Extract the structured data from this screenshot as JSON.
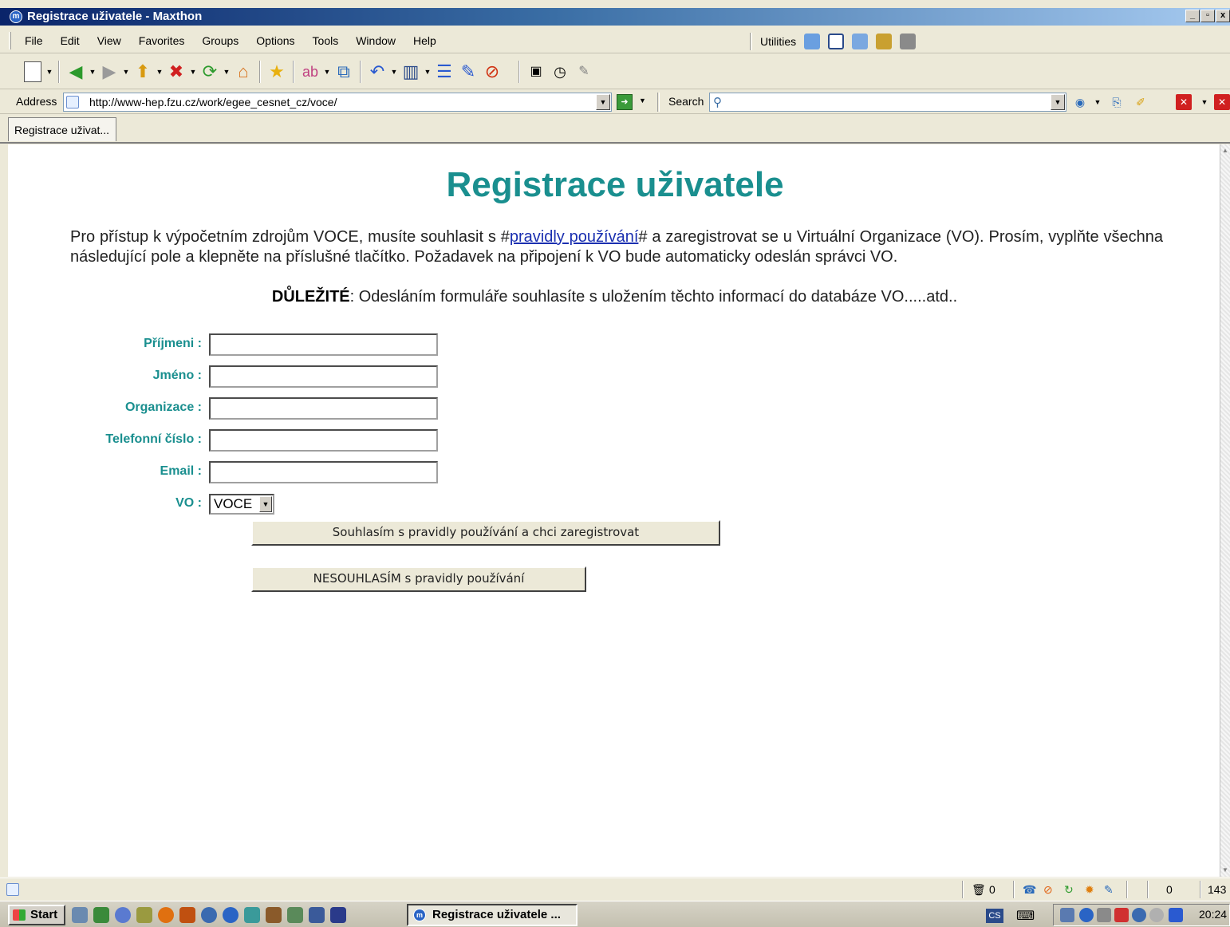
{
  "window": {
    "title": "Registrace uživatele - Maxthon",
    "min": "_",
    "max": "▫",
    "close": "x"
  },
  "menubar": {
    "items": [
      {
        "label": "File",
        "key": "F"
      },
      {
        "label": "Edit",
        "key": "E"
      },
      {
        "label": "View",
        "key": "V"
      },
      {
        "label": "Favorites",
        "key": "a"
      },
      {
        "label": "Groups",
        "key": "G"
      },
      {
        "label": "Options",
        "key": "O"
      },
      {
        "label": "Tools",
        "key": "T"
      },
      {
        "label": "Window",
        "key": "W"
      },
      {
        "label": "Help",
        "key": "H"
      }
    ],
    "utilities_label": "Utilities"
  },
  "address": {
    "label": "Address",
    "url": "http://www-hep.fzu.cz/work/egee_cesnet_cz/voce/",
    "search_label": "Search",
    "search_value": ""
  },
  "tabs": [
    {
      "label": "Registrace uživat..."
    }
  ],
  "page": {
    "heading": "Registrace uživatele",
    "intro_before": "Pro přístup k výpočetním zdrojům VOCE, musíte souhlasit s #",
    "intro_link": "pravidly používání",
    "intro_after": "# a zaregistrovat se u Virtuální Organizace (VO). Prosím, vyplňte všechna následující pole a klepněte na příslušné tlačítko. Požadavek na připojení k VO bude automaticky odeslán správci VO.",
    "notice_bold": "DŮLEŽITÉ",
    "notice_rest": ": Odesláním formuláře souhlasíte s uložením těchto informací do databáze VO.....atd..",
    "form": {
      "surname_label": "Příjmeni :",
      "surname_value": "",
      "name_label": "Jméno :",
      "name_value": "",
      "org_label": "Organizace :",
      "org_value": "",
      "phone_label": "Telefonní číslo :",
      "phone_value": "",
      "email_label": "Email :",
      "email_value": "",
      "vo_label": "VO :",
      "vo_selected": "VOCE",
      "agree_button": "Souhlasím s pravidly používání a chci zaregistrovat",
      "disagree_button": "NESOUHLASÍM s pravidly používání"
    }
  },
  "statusbar": {
    "trash_count": "0",
    "counter": "0",
    "right_value": "143"
  },
  "taskbar": {
    "start_label": "Start",
    "window_label": "Registrace uživatele ...",
    "lang": "CS",
    "clock": "20:24"
  },
  "icons": [
    "app-icon",
    "new-page-icon",
    "back-icon",
    "forward-icon",
    "up-icon",
    "stop-icon",
    "refresh-icon",
    "home-icon",
    "favorites-star-icon",
    "spellcheck-icon",
    "window-icon",
    "undo-icon",
    "columns-icon",
    "list-icon",
    "edit-icon",
    "blocked-icon",
    "screenshot-icon",
    "compass-icon",
    "tool-icon",
    "search-icon",
    "page-icon",
    "go-icon",
    "trash-icon"
  ]
}
